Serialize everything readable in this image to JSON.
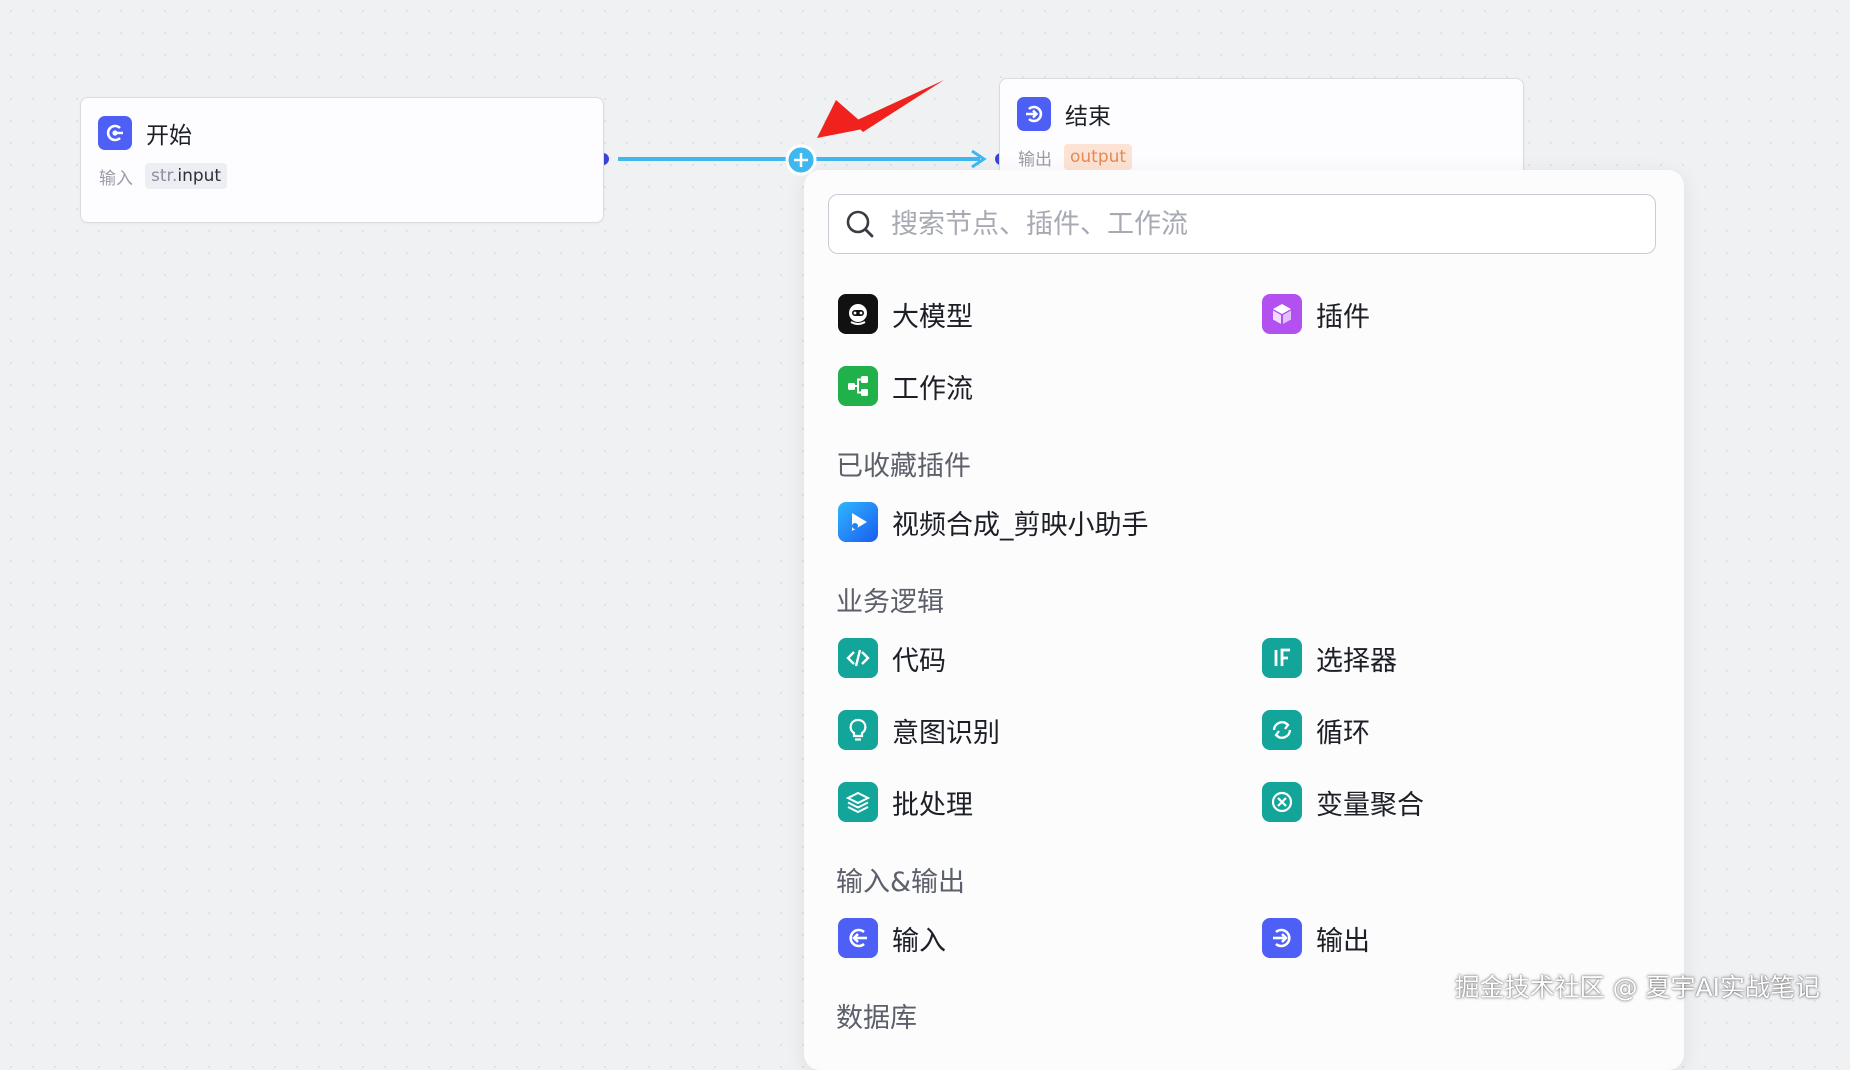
{
  "start_node": {
    "title": "开始",
    "input_key": "输入",
    "input_type": "str.",
    "input_name": "input"
  },
  "end_node": {
    "title": "结束",
    "output_key": "输出",
    "output_name": "output"
  },
  "panel": {
    "search_placeholder": "搜索节点、插件、工作流",
    "top_items": [
      {
        "label": "大模型",
        "icon": "llm-robot-icon",
        "color": "#111111"
      },
      {
        "label": "插件",
        "icon": "plugin-cube-icon",
        "color": "#b350f0"
      },
      {
        "label": "工作流",
        "icon": "workflow-icon",
        "color": "#21b14a"
      }
    ],
    "sections": [
      {
        "title": "已收藏插件",
        "items": [
          {
            "label": "视频合成_剪映小助手",
            "icon": "video-play-icon",
            "color": "#1a83f5"
          }
        ]
      },
      {
        "title": "业务逻辑",
        "items": [
          {
            "label": "代码",
            "icon": "code-icon",
            "color": "#13a59a"
          },
          {
            "label": "选择器",
            "icon": "if-selector-icon",
            "color": "#13a59a"
          },
          {
            "label": "意图识别",
            "icon": "intent-bulb-icon",
            "color": "#13a59a"
          },
          {
            "label": "循环",
            "icon": "loop-icon",
            "color": "#13a59a"
          },
          {
            "label": "批处理",
            "icon": "batch-layers-icon",
            "color": "#13a59a"
          },
          {
            "label": "变量聚合",
            "icon": "variable-aggregate-icon",
            "color": "#13a59a"
          }
        ]
      },
      {
        "title": "输入&输出",
        "items": [
          {
            "label": "输入",
            "icon": "input-arrow-icon",
            "color": "#4e5ff6"
          },
          {
            "label": "输出",
            "icon": "output-arrow-icon",
            "color": "#4e5ff6"
          }
        ]
      },
      {
        "title": "数据库",
        "items": []
      }
    ]
  },
  "watermark": "掘金技术社区 @ 夏宇AI实战笔记",
  "colors": {
    "accent": "#4e5ff6",
    "wire": "#3fb8f0",
    "annotation": "#f0221e"
  }
}
